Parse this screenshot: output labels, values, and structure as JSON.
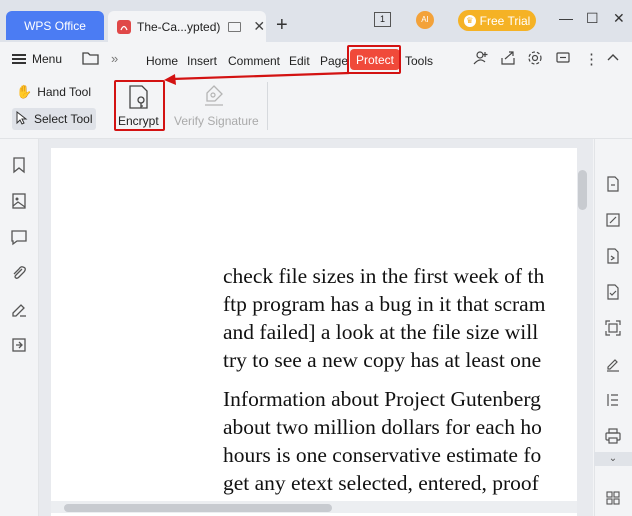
{
  "titlebar": {
    "app_tab": "WPS Office",
    "doc_tab": "The-Ca...ypted)",
    "window_count": "1",
    "ai_badge": "AI",
    "free_trial": "Free Trial"
  },
  "menu": {
    "menu_label": "Menu",
    "tabs": [
      "Home",
      "Insert",
      "Comment",
      "Edit",
      "Page",
      "Protect",
      "Tools"
    ],
    "active_tab": "Protect"
  },
  "ribbon": {
    "hand_tool": "Hand Tool",
    "select_tool": "Select Tool",
    "encrypt": "Encrypt",
    "verify_signature": "Verify Signature"
  },
  "document": {
    "lines": [
      "check file sizes in the first week of th",
      "ftp program has a bug in it that scram",
      "and failed] a look at the file size will",
      "try to see a new copy has at least one",
      "Information about Project Gutenberg",
      "about two million dollars for each ho",
      "hours is one conservative estimate fo",
      "get any etext selected, entered, proof"
    ]
  },
  "colors": {
    "accent_blue": "#4b7cf3",
    "protect_red": "#f04a3a",
    "highlight_red": "#d31212",
    "trial_gold": "#f5b225"
  }
}
